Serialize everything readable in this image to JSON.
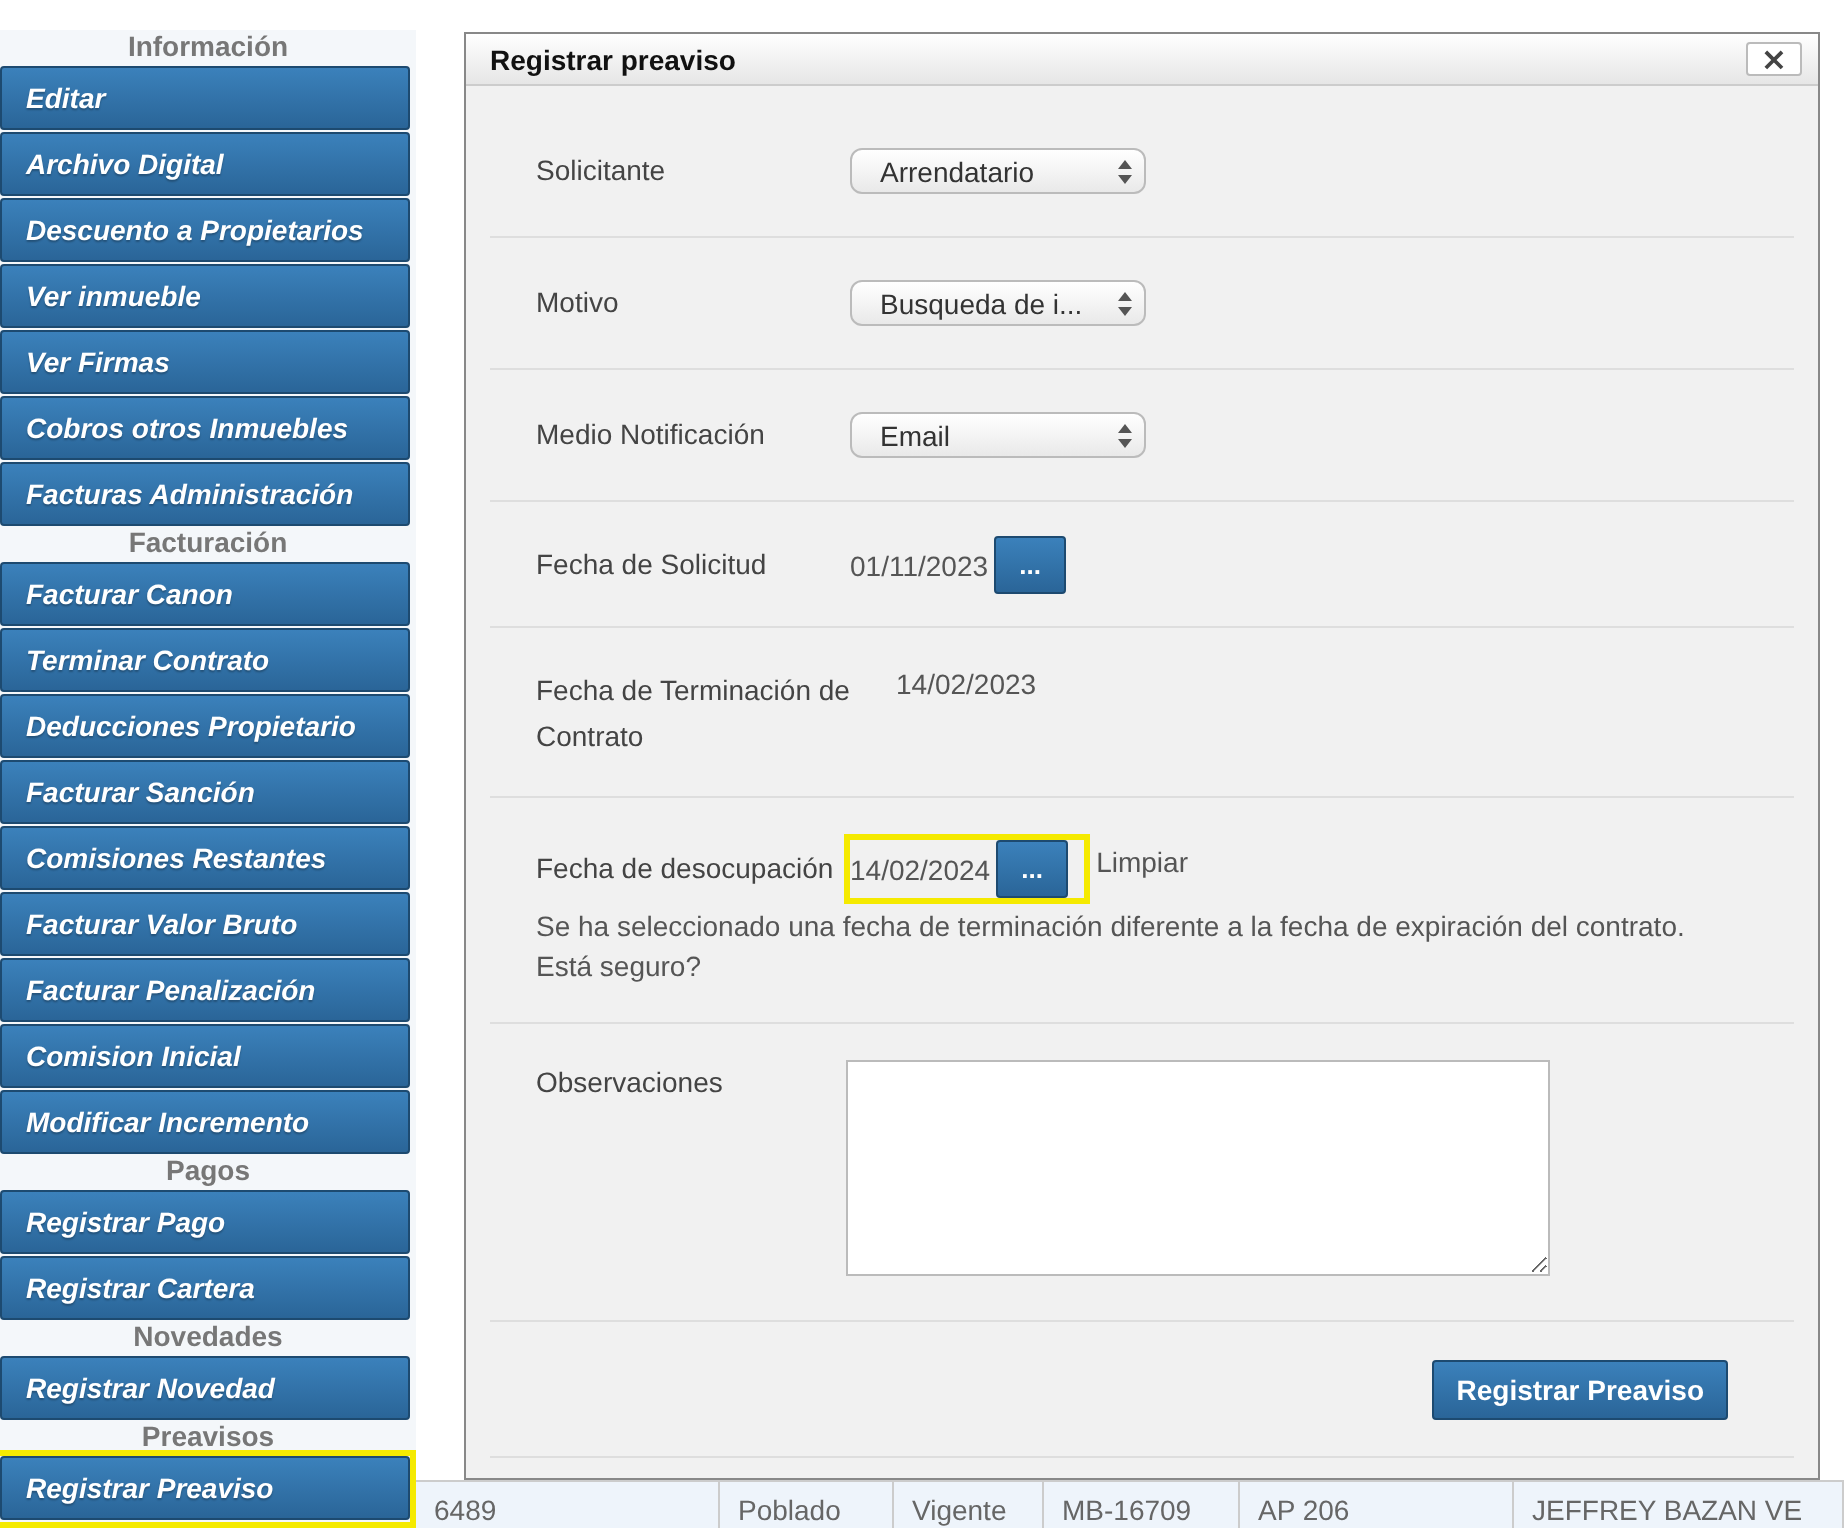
{
  "sidebar": {
    "sections": [
      {
        "title": "Información",
        "items": [
          {
            "label": "Editar",
            "highlighted": false
          },
          {
            "label": "Archivo Digital",
            "highlighted": false
          },
          {
            "label": "Descuento a Propietarios",
            "highlighted": false
          },
          {
            "label": "Ver inmueble",
            "highlighted": false
          },
          {
            "label": "Ver Firmas",
            "highlighted": false
          },
          {
            "label": "Cobros otros Inmuebles",
            "highlighted": false
          },
          {
            "label": "Facturas Administración",
            "highlighted": false
          }
        ]
      },
      {
        "title": "Facturación",
        "items": [
          {
            "label": "Facturar Canon",
            "highlighted": false
          },
          {
            "label": "Terminar Contrato",
            "highlighted": false
          },
          {
            "label": "Deducciones Propietario",
            "highlighted": false
          },
          {
            "label": "Facturar Sanción",
            "highlighted": false
          },
          {
            "label": "Comisiones Restantes",
            "highlighted": false
          },
          {
            "label": "Facturar Valor Bruto",
            "highlighted": false
          },
          {
            "label": "Facturar Penalización",
            "highlighted": false
          },
          {
            "label": "Comision Inicial",
            "highlighted": false
          },
          {
            "label": "Modificar Incremento",
            "highlighted": false
          }
        ]
      },
      {
        "title": "Pagos",
        "items": [
          {
            "label": "Registrar Pago",
            "highlighted": false
          },
          {
            "label": "Registrar Cartera",
            "highlighted": false
          }
        ]
      },
      {
        "title": "Novedades",
        "items": [
          {
            "label": "Registrar Novedad",
            "highlighted": false
          }
        ]
      },
      {
        "title": "Preavisos",
        "items": [
          {
            "label": "Registrar Preaviso",
            "highlighted": true
          }
        ]
      }
    ]
  },
  "background_table": {
    "bottom_row": [
      "6489",
      "Poblado",
      "Vigente",
      "MB-16709",
      "AP 206",
      "JEFFREY BAZAN VE"
    ]
  },
  "dialog": {
    "title": "Registrar preaviso",
    "close": "×",
    "fields": [
      {
        "kind": "select",
        "label": "Solicitante",
        "value": "Arrendatario"
      },
      {
        "kind": "select",
        "label": "Motivo",
        "value": "Busqueda de i..."
      },
      {
        "kind": "select",
        "label": "Medio Notificación",
        "value": "Email"
      },
      {
        "kind": "date",
        "label": "Fecha de Solicitud",
        "value": "01/11/2023",
        "button": "...",
        "highlighted": false
      },
      {
        "kind": "text",
        "label": "Fecha de Terminación de Contrato",
        "value": "14/02/2023"
      },
      {
        "kind": "date",
        "label": "Fecha de desocupación",
        "value": "14/02/2024",
        "button": "...",
        "highlighted": true,
        "clear": "Limpiar",
        "warning": "Se ha seleccionado una fecha de terminación diferente a la fecha de expiración del contrato. Está seguro?"
      },
      {
        "kind": "textarea",
        "label": "Observaciones"
      }
    ],
    "submit": "Registrar Preaviso"
  }
}
